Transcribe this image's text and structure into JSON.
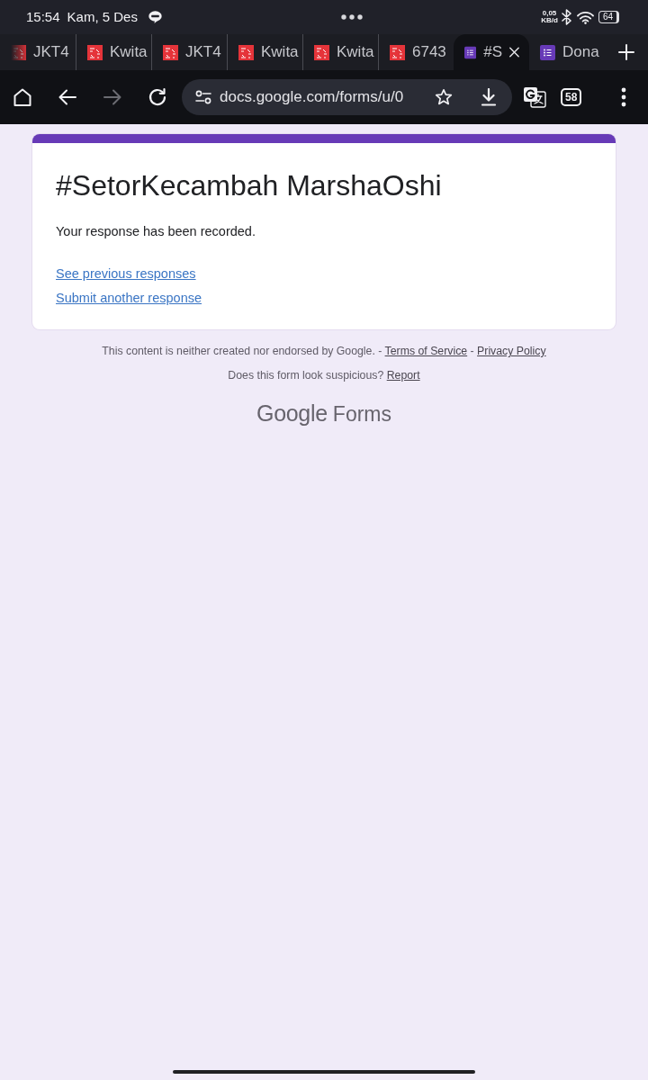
{
  "status_bar": {
    "time": "15:54",
    "date": "Kam, 5 Des",
    "net_speed": "0,05",
    "net_unit": "KB/d",
    "battery": "64"
  },
  "tabs": [
    {
      "title": "JKT4",
      "kind": "image",
      "faded": true,
      "selected": false
    },
    {
      "title": "Kwita",
      "kind": "image",
      "faded": false,
      "selected": false
    },
    {
      "title": "JKT4",
      "kind": "image",
      "faded": false,
      "selected": false
    },
    {
      "title": "Kwita",
      "kind": "image",
      "faded": false,
      "selected": false
    },
    {
      "title": "Kwita",
      "kind": "image",
      "faded": false,
      "selected": false
    },
    {
      "title": "6743",
      "kind": "image",
      "faded": false,
      "selected": false
    },
    {
      "title": "#S",
      "kind": "form",
      "faded": false,
      "selected": true
    },
    {
      "title": "Dona",
      "kind": "form",
      "faded": false,
      "selected": false
    }
  ],
  "toolbar": {
    "forward_disabled": true,
    "url": "docs.google.com/forms/u/0",
    "tab_count": "58"
  },
  "form": {
    "title": "#SetorKecambah MarshaOshi",
    "message": "Your response has been recorded.",
    "links": [
      "See previous responses",
      "Submit another response"
    ]
  },
  "footer": {
    "lines": [
      [
        {
          "kind": "text",
          "text": "This content is neither created nor endorsed by Google. - "
        },
        {
          "kind": "link",
          "text": "Terms of Service"
        },
        {
          "kind": "text",
          "text": " - "
        },
        {
          "kind": "link",
          "text": "Privacy Policy"
        }
      ],
      [
        {
          "kind": "text",
          "text": "Does this form look suspicious? "
        },
        {
          "kind": "link",
          "text": "Report"
        }
      ]
    ],
    "brand": "Google",
    "product": "Forms"
  }
}
